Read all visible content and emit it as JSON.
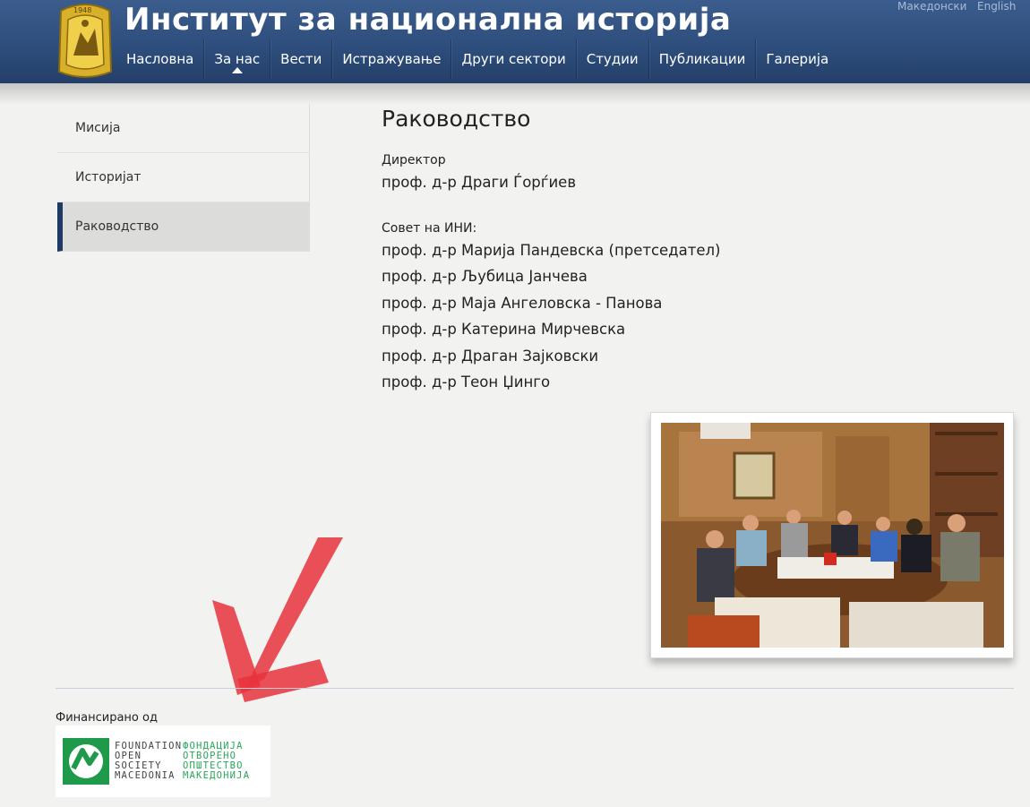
{
  "header": {
    "site_title": "Институт за национална историја",
    "lang_mk": "Македонски",
    "lang_en": "English",
    "logo_year": "1948",
    "nav": [
      {
        "label": "Насловна"
      },
      {
        "label": "За нас",
        "active": true
      },
      {
        "label": "Вести"
      },
      {
        "label": "Истражување"
      },
      {
        "label": "Други сектори"
      },
      {
        "label": "Студии"
      },
      {
        "label": "Публикации"
      },
      {
        "label": "Галерија"
      }
    ]
  },
  "sidebar": {
    "items": [
      {
        "label": "Мисија"
      },
      {
        "label": "Историјат"
      },
      {
        "label": "Раководство",
        "active": true
      }
    ]
  },
  "main": {
    "title": "Раководство",
    "director_label": "Директор",
    "director": "проф. д-р Драги Ѓорѓиев",
    "council_label": "Совет на ИНИ:",
    "council": [
      "проф. д-р Марија Пандевска (претседател)",
      "проф. д-р Љубица Јанчева",
      "проф. д-р Маја Ангеловска - Панова",
      "проф. д-р Катерина Мирчевска",
      "проф. д-р Драган Зајковски",
      "проф. д-р Теон Џинго"
    ]
  },
  "footer": {
    "funded_by": "Финансирано од",
    "osf_en": [
      "FOUNDATION",
      "OPEN",
      "SOCIETY",
      "MACEDONIA"
    ],
    "osf_mk": [
      "ФОНДАЦИЈА",
      "ОТВОРЕНО",
      "ОПШТЕСТВО",
      "МАКЕДОНИЈА"
    ]
  },
  "colors": {
    "header": "#2e4e7d",
    "active_marker": "#1f3b63",
    "arrow": "#e8323c",
    "osf_green": "#2aa65a"
  }
}
